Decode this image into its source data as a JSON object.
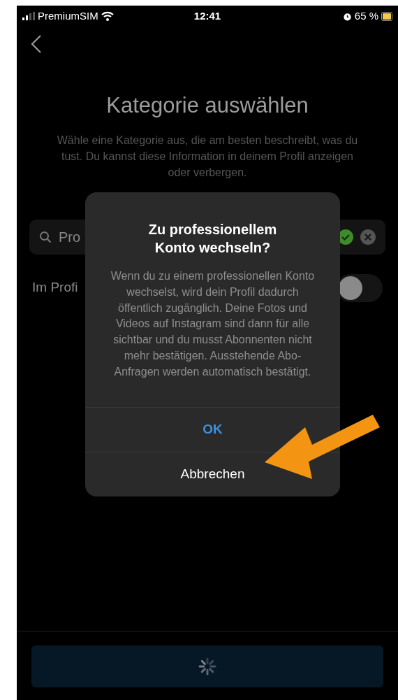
{
  "status_bar": {
    "carrier": "PremiumSIM",
    "time": "12:41",
    "battery": "65 %"
  },
  "header": {
    "title": "Kategorie auswählen",
    "subtitle": "Wähle eine Kategorie aus, die am besten beschreibt, was du tust. Du kannst diese Information in deinem Profil anzeigen oder verbergen."
  },
  "search": {
    "value": "Pro",
    "valid": true
  },
  "profile_toggle": {
    "label": "Im Profi",
    "on": false
  },
  "footer_button": {
    "loading": true
  },
  "dialog": {
    "title": "Zu professionellem Konto wechseln?",
    "message": "Wenn du zu einem professionellen Konto wechselst, wird dein Profil dadurch öffentlich zugänglich. Deine Fotos und Videos auf Instagram sind dann für alle sichtbar und du musst Abonnenten nicht mehr bestätigen. Ausstehende Abo-Anfragen werden automatisch bestätigt.",
    "buttons": [
      {
        "label": "OK",
        "kind": "primary"
      },
      {
        "label": "Abbrechen",
        "kind": "cancel"
      }
    ]
  },
  "annotation": {
    "kind": "arrow"
  }
}
